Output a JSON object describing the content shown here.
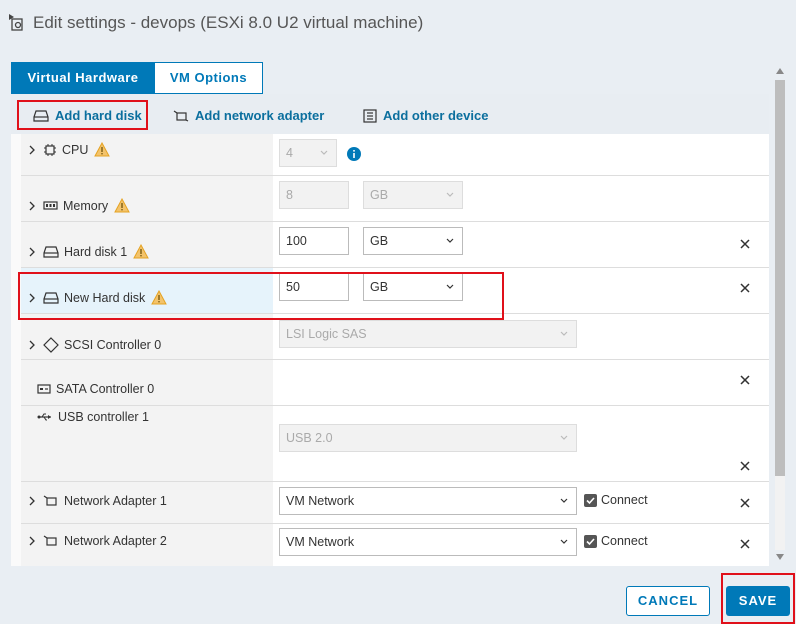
{
  "window": {
    "title": "Edit settings - devops (ESXi 8.0 U2 virtual machine)"
  },
  "tabs": [
    {
      "label": "Virtual Hardware",
      "active": true
    },
    {
      "label": "VM Options",
      "active": false
    }
  ],
  "toolbar": {
    "add_hard_disk": "Add hard disk",
    "add_network_adapter": "Add network adapter",
    "add_other_device": "Add other device"
  },
  "devices": {
    "cpu": {
      "label": "CPU",
      "value": "4"
    },
    "memory": {
      "label": "Memory",
      "value": "8",
      "unit": "GB"
    },
    "hard_disk_1": {
      "label": "Hard disk 1",
      "value": "100",
      "unit": "GB"
    },
    "new_hard_disk": {
      "label": "New Hard disk",
      "value": "50",
      "unit": "GB"
    },
    "scsi_controller": {
      "label": "SCSI Controller 0",
      "value": "LSI Logic SAS"
    },
    "sata_controller": {
      "label": "SATA Controller 0"
    },
    "usb_controller": {
      "label": "USB controller 1",
      "value": "USB 2.0"
    },
    "network_adapter_1": {
      "label": "Network Adapter 1",
      "value": "VM Network",
      "connect_label": "Connect",
      "connected": true
    },
    "network_adapter_2": {
      "label": "Network Adapter 2",
      "value": "VM Network",
      "connect_label": "Connect",
      "connected": true
    }
  },
  "footer": {
    "cancel_label": "CANCEL",
    "save_label": "SAVE"
  },
  "colors": {
    "accent": "#0079b8",
    "warning": "#e5a323",
    "highlight": "#e0101a"
  }
}
